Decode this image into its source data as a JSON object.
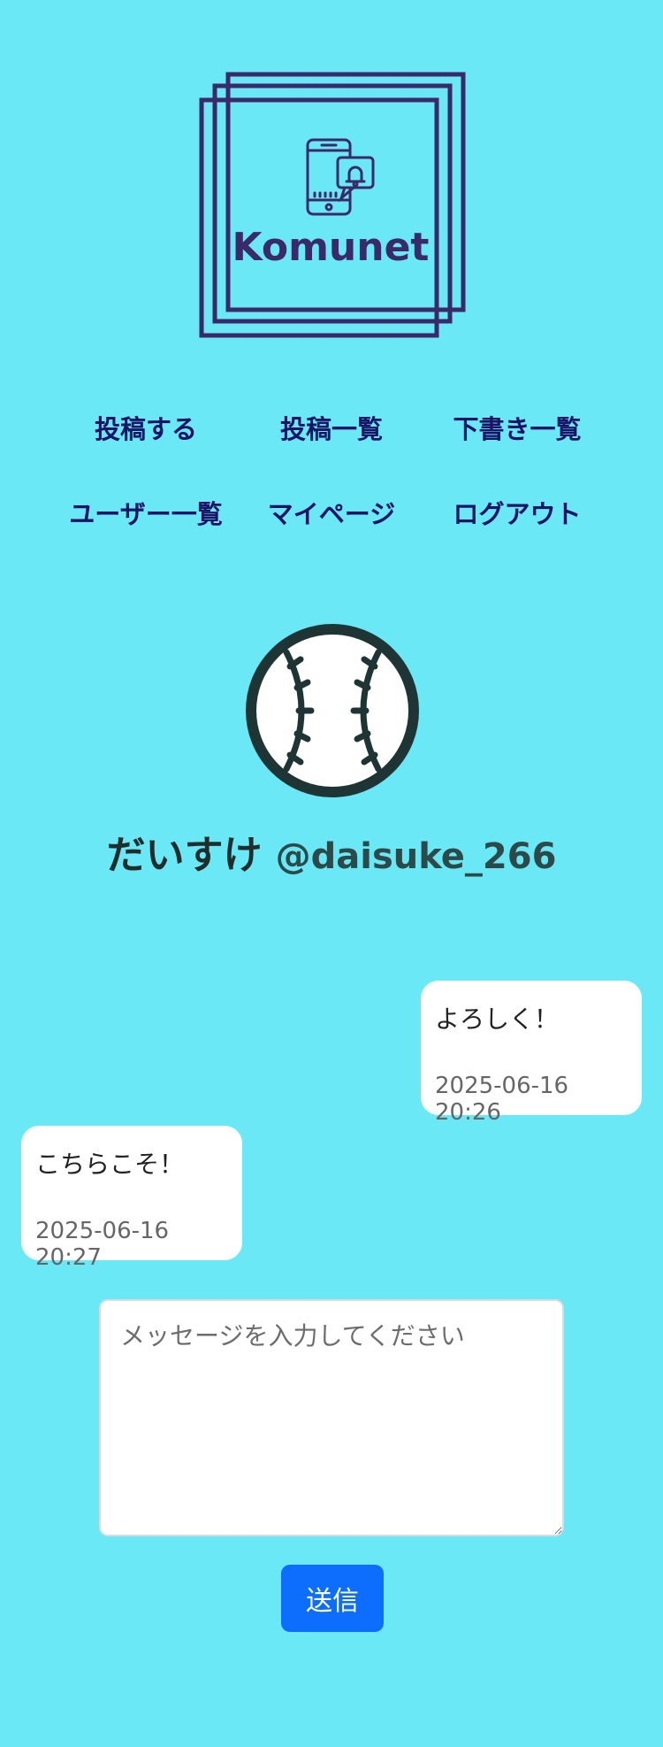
{
  "app": {
    "logo_text": "Komunet"
  },
  "colors": {
    "background": "#6be8f6",
    "nav_text": "#1a1466",
    "logo": "#3b2a6b",
    "send_button": "#0d6efd"
  },
  "nav": {
    "items": [
      {
        "label": "投稿する"
      },
      {
        "label": "投稿一覧"
      },
      {
        "label": "下書き一覧"
      },
      {
        "label": "ユーザー一覧"
      },
      {
        "label": "マイページ"
      },
      {
        "label": "ログアウト"
      }
    ]
  },
  "profile": {
    "avatar_icon": "baseball-icon",
    "display_name": "だいすけ",
    "handle": "@daisuke_266"
  },
  "messages": [
    {
      "side": "right",
      "text": "よろしく！",
      "timestamp": "2025-06-16 20:26"
    },
    {
      "side": "left",
      "text": "こちらこそ！",
      "timestamp": "2025-06-16 20:27"
    }
  ],
  "composer": {
    "placeholder": "メッセージを入力してください",
    "value": "",
    "send_label": "送信"
  }
}
